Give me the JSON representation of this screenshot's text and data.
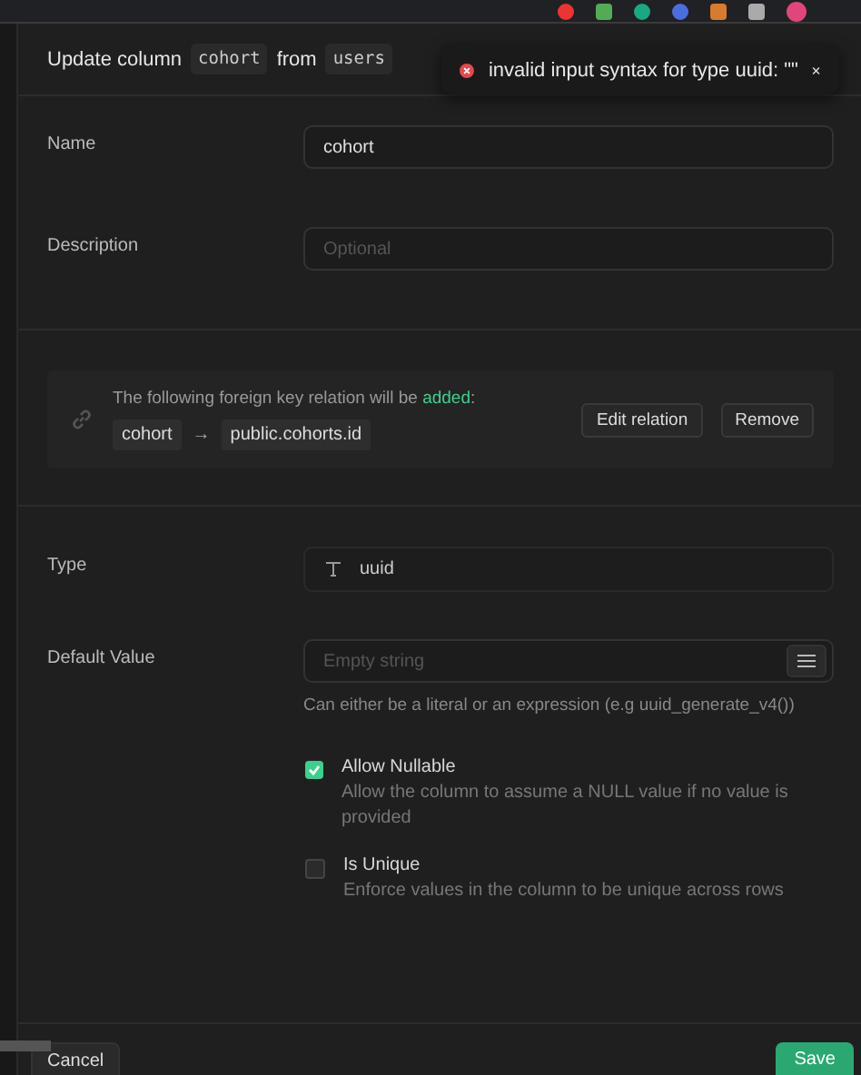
{
  "header": {
    "prefix": "Update column",
    "column": "cohort",
    "joiner": "from",
    "table": "users"
  },
  "toast": {
    "kind": "error",
    "message": "invalid input syntax for type uuid: \"\""
  },
  "fields": [
    {
      "label": "Name",
      "value": "cohort"
    },
    {
      "label": "Description",
      "placeholder": "Optional"
    }
  ],
  "relation": {
    "message_before": "The following foreign key relation will be ",
    "action": "added",
    "message_after": ":",
    "source": "cohort",
    "arrow": "→",
    "target": "public.cohorts.id",
    "buttons": [
      "Edit relation",
      "Remove"
    ]
  },
  "type": {
    "label": "Type",
    "value": "uuid"
  },
  "default_value": {
    "label": "Default Value",
    "placeholder": "Empty string",
    "help": "Can either be a literal or an expression (e.g uuid_generate_v4())"
  },
  "options": [
    {
      "label": "Allow Nullable",
      "description": "Allow the column to assume a NULL value if no value is provided",
      "checked": true
    },
    {
      "label": "Is Unique",
      "description": "Enforce values in the column to be unique across rows",
      "checked": false
    }
  ],
  "footer": {
    "cancel": "Cancel",
    "save": "Save"
  }
}
